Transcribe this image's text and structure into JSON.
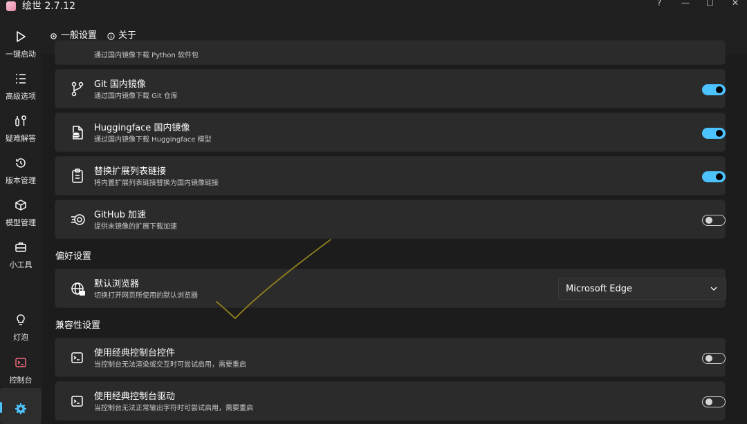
{
  "window": {
    "title": "绘世 2.7.12",
    "controls": {
      "help": "?",
      "minimize": "—",
      "maximize": "☐",
      "close": "✕"
    }
  },
  "sidebar": {
    "items": [
      {
        "label": "一键启动",
        "icon": "play-icon"
      },
      {
        "label": "高级选项",
        "icon": "list-icon"
      },
      {
        "label": "疑难解答",
        "icon": "tools-icon"
      },
      {
        "label": "版本管理",
        "icon": "history-icon"
      },
      {
        "label": "模型管理",
        "icon": "cube-icon"
      },
      {
        "label": "小工具",
        "icon": "toolbox-icon"
      },
      {
        "label": "灯泡",
        "icon": "lightbulb-icon"
      },
      {
        "label": "控制台",
        "icon": "console-icon"
      },
      {
        "label": "",
        "icon": "gear-icon",
        "active": true
      }
    ],
    "accent": "#4cc2ff",
    "console_icon_color": "#f06a7a"
  },
  "tabs": [
    {
      "label": "一般设置",
      "icon": "gear-icon"
    },
    {
      "label": "关于",
      "icon": "info-icon"
    }
  ],
  "content": {
    "partial_card_sub": "通过国内镜像下载 Python 软件包",
    "mirror_cards": [
      {
        "title": "Git 国内镜像",
        "subtitle": "通过国内镜像下载 Git 仓库",
        "icon": "git-branch-icon",
        "enabled": true
      },
      {
        "title": "Huggingface 国内镜像",
        "subtitle": "通过国内镜像下载 Huggingface 模型",
        "icon": "database-file-icon",
        "enabled": true
      },
      {
        "title": "替换扩展列表链接",
        "subtitle": "将内置扩展列表链接替换为国内镜像链接",
        "icon": "clipboard-icon",
        "enabled": true
      },
      {
        "title": "GitHub 加速",
        "subtitle": "提供未镜像的扩展下载加速",
        "icon": "speed-icon",
        "enabled": false
      }
    ],
    "preferences": {
      "section_title": "偏好设置",
      "browser": {
        "title": "默认浏览器",
        "subtitle": "切换打开网页所使用的默认浏览器",
        "icon": "globe-icon",
        "value": "Microsoft Edge"
      }
    },
    "compat": {
      "section_title": "兼容性设置",
      "cards": [
        {
          "title": "使用经典控制台控件",
          "subtitle": "当控制台无法渲染或交互时可尝试启用，需要重启",
          "icon": "terminal-icon",
          "enabled": false
        },
        {
          "title": "使用经典控制台驱动",
          "subtitle": "当控制台无法正常输出字符时可尝试启用，需要重启",
          "icon": "terminal-icon",
          "enabled": false
        }
      ]
    },
    "annotation_color": "#8a7a1e"
  }
}
